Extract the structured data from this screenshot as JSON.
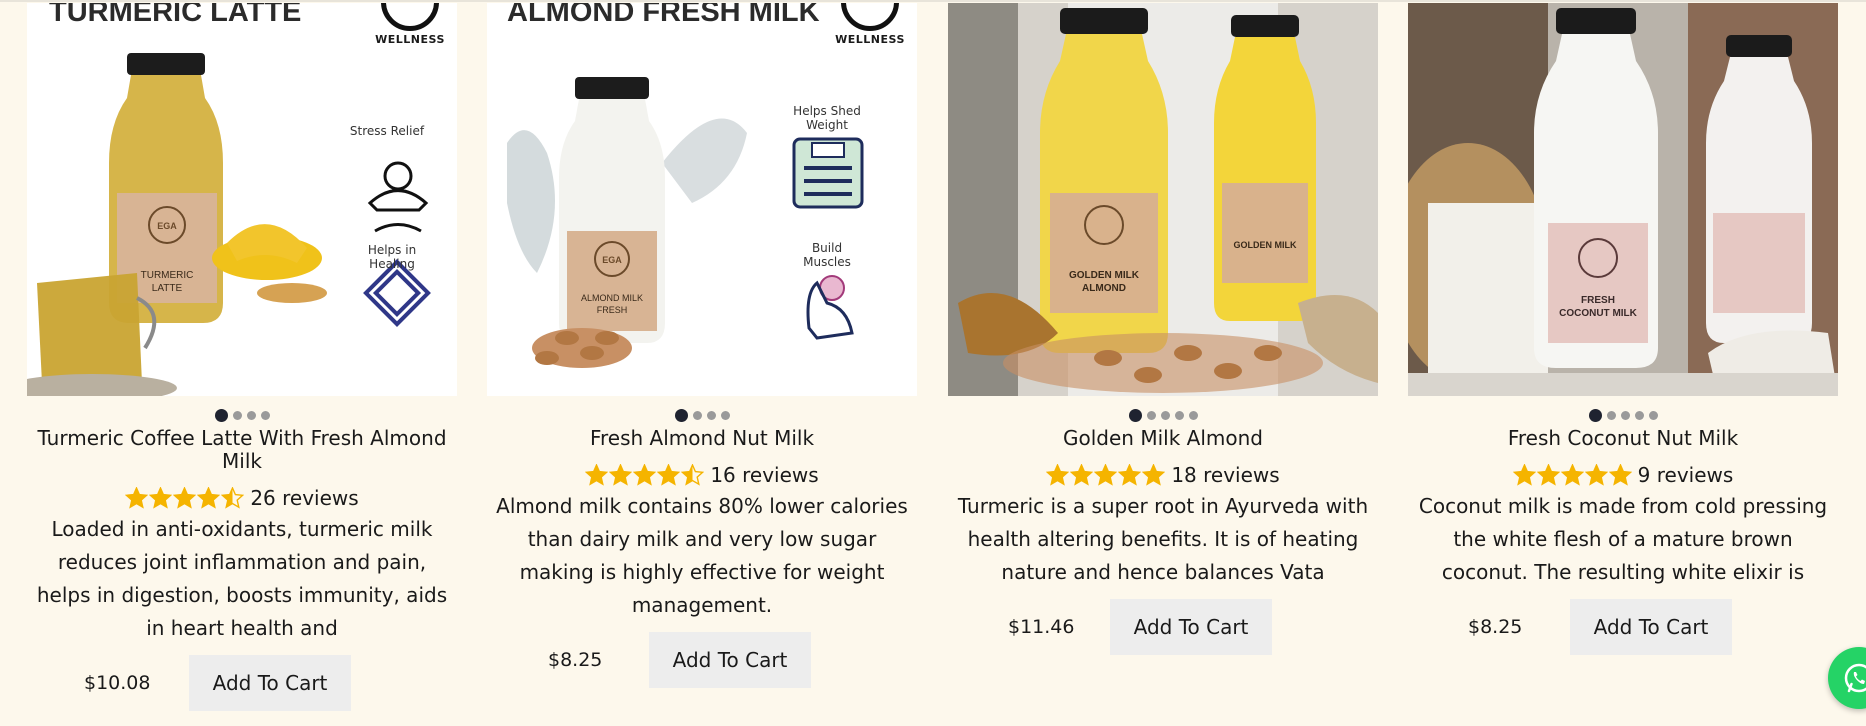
{
  "colors": {
    "background": "#fdf8ec",
    "star": "#f5b400",
    "button_bg": "#ededed",
    "whatsapp": "#25d366"
  },
  "products": [
    {
      "title": "Turmeric Coffee Latte With Fresh Almond Milk",
      "image": {
        "headline": "TURMERIC LATTE",
        "brand": "EGA",
        "brand_sub": "WELLNESS",
        "benefits": [
          "Stress Relief",
          "Helps in Healing"
        ]
      },
      "slides": 4,
      "active_slide": 1,
      "rating": 4.5,
      "reviews": "26 reviews",
      "description": "Loaded in anti-oxidants, turmeric milk reduces joint inflammation and pain, helps in digestion, boosts immunity, aids in heart health and",
      "price": "$10.08",
      "button": "Add To Cart"
    },
    {
      "title": "Fresh Almond Nut Milk",
      "image": {
        "headline": "ALMOND FRESH MILK",
        "brand": "EGA",
        "brand_sub": "WELLNESS",
        "benefits": [
          "Helps Shed Weight",
          "Build Muscles"
        ]
      },
      "slides": 4,
      "active_slide": 1,
      "rating": 4.5,
      "reviews": "16 reviews",
      "description": "Almond milk contains 80% lower calories than dairy milk and very low sugar making is highly effective for weight management.",
      "price": "$8.25",
      "button": "Add To Cart"
    },
    {
      "title": "Golden Milk Almond",
      "image": {
        "label": "GOLDEN MILK ALMOND"
      },
      "slides": 5,
      "active_slide": 1,
      "rating": 5,
      "reviews": "18 reviews",
      "description": "Turmeric is a super root in Ayurveda with health altering benefits. It is of heating nature and hence balances Vata",
      "price": "$11.46",
      "button": "Add To Cart"
    },
    {
      "title": "Fresh Coconut Nut Milk",
      "image": {
        "label": "FRESH COCONUT MILK"
      },
      "slides": 5,
      "active_slide": 1,
      "rating": 5,
      "reviews": "9 reviews",
      "description": "Coconut milk is made from cold pressing the white flesh of a mature brown coconut. The resulting white elixir is",
      "price": "$8.25",
      "button": "Add To Cart"
    }
  ],
  "whatsapp": {
    "icon": "whatsapp-icon"
  }
}
